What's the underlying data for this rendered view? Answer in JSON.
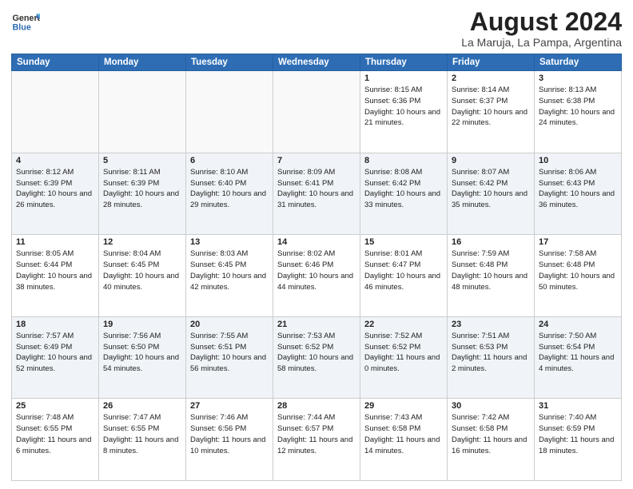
{
  "header": {
    "month": "August 2024",
    "location": "La Maruja, La Pampa, Argentina",
    "logo_line1": "General",
    "logo_line2": "Blue"
  },
  "weekdays": [
    "Sunday",
    "Monday",
    "Tuesday",
    "Wednesday",
    "Thursday",
    "Friday",
    "Saturday"
  ],
  "weeks": [
    [
      {
        "day": "",
        "sunrise": "",
        "sunset": "",
        "daylight": ""
      },
      {
        "day": "",
        "sunrise": "",
        "sunset": "",
        "daylight": ""
      },
      {
        "day": "",
        "sunrise": "",
        "sunset": "",
        "daylight": ""
      },
      {
        "day": "",
        "sunrise": "",
        "sunset": "",
        "daylight": ""
      },
      {
        "day": "1",
        "sunrise": "Sunrise: 8:15 AM",
        "sunset": "Sunset: 6:36 PM",
        "daylight": "Daylight: 10 hours and 21 minutes."
      },
      {
        "day": "2",
        "sunrise": "Sunrise: 8:14 AM",
        "sunset": "Sunset: 6:37 PM",
        "daylight": "Daylight: 10 hours and 22 minutes."
      },
      {
        "day": "3",
        "sunrise": "Sunrise: 8:13 AM",
        "sunset": "Sunset: 6:38 PM",
        "daylight": "Daylight: 10 hours and 24 minutes."
      }
    ],
    [
      {
        "day": "4",
        "sunrise": "Sunrise: 8:12 AM",
        "sunset": "Sunset: 6:39 PM",
        "daylight": "Daylight: 10 hours and 26 minutes."
      },
      {
        "day": "5",
        "sunrise": "Sunrise: 8:11 AM",
        "sunset": "Sunset: 6:39 PM",
        "daylight": "Daylight: 10 hours and 28 minutes."
      },
      {
        "day": "6",
        "sunrise": "Sunrise: 8:10 AM",
        "sunset": "Sunset: 6:40 PM",
        "daylight": "Daylight: 10 hours and 29 minutes."
      },
      {
        "day": "7",
        "sunrise": "Sunrise: 8:09 AM",
        "sunset": "Sunset: 6:41 PM",
        "daylight": "Daylight: 10 hours and 31 minutes."
      },
      {
        "day": "8",
        "sunrise": "Sunrise: 8:08 AM",
        "sunset": "Sunset: 6:42 PM",
        "daylight": "Daylight: 10 hours and 33 minutes."
      },
      {
        "day": "9",
        "sunrise": "Sunrise: 8:07 AM",
        "sunset": "Sunset: 6:42 PM",
        "daylight": "Daylight: 10 hours and 35 minutes."
      },
      {
        "day": "10",
        "sunrise": "Sunrise: 8:06 AM",
        "sunset": "Sunset: 6:43 PM",
        "daylight": "Daylight: 10 hours and 36 minutes."
      }
    ],
    [
      {
        "day": "11",
        "sunrise": "Sunrise: 8:05 AM",
        "sunset": "Sunset: 6:44 PM",
        "daylight": "Daylight: 10 hours and 38 minutes."
      },
      {
        "day": "12",
        "sunrise": "Sunrise: 8:04 AM",
        "sunset": "Sunset: 6:45 PM",
        "daylight": "Daylight: 10 hours and 40 minutes."
      },
      {
        "day": "13",
        "sunrise": "Sunrise: 8:03 AM",
        "sunset": "Sunset: 6:45 PM",
        "daylight": "Daylight: 10 hours and 42 minutes."
      },
      {
        "day": "14",
        "sunrise": "Sunrise: 8:02 AM",
        "sunset": "Sunset: 6:46 PM",
        "daylight": "Daylight: 10 hours and 44 minutes."
      },
      {
        "day": "15",
        "sunrise": "Sunrise: 8:01 AM",
        "sunset": "Sunset: 6:47 PM",
        "daylight": "Daylight: 10 hours and 46 minutes."
      },
      {
        "day": "16",
        "sunrise": "Sunrise: 7:59 AM",
        "sunset": "Sunset: 6:48 PM",
        "daylight": "Daylight: 10 hours and 48 minutes."
      },
      {
        "day": "17",
        "sunrise": "Sunrise: 7:58 AM",
        "sunset": "Sunset: 6:48 PM",
        "daylight": "Daylight: 10 hours and 50 minutes."
      }
    ],
    [
      {
        "day": "18",
        "sunrise": "Sunrise: 7:57 AM",
        "sunset": "Sunset: 6:49 PM",
        "daylight": "Daylight: 10 hours and 52 minutes."
      },
      {
        "day": "19",
        "sunrise": "Sunrise: 7:56 AM",
        "sunset": "Sunset: 6:50 PM",
        "daylight": "Daylight: 10 hours and 54 minutes."
      },
      {
        "day": "20",
        "sunrise": "Sunrise: 7:55 AM",
        "sunset": "Sunset: 6:51 PM",
        "daylight": "Daylight: 10 hours and 56 minutes."
      },
      {
        "day": "21",
        "sunrise": "Sunrise: 7:53 AM",
        "sunset": "Sunset: 6:52 PM",
        "daylight": "Daylight: 10 hours and 58 minutes."
      },
      {
        "day": "22",
        "sunrise": "Sunrise: 7:52 AM",
        "sunset": "Sunset: 6:52 PM",
        "daylight": "Daylight: 11 hours and 0 minutes."
      },
      {
        "day": "23",
        "sunrise": "Sunrise: 7:51 AM",
        "sunset": "Sunset: 6:53 PM",
        "daylight": "Daylight: 11 hours and 2 minutes."
      },
      {
        "day": "24",
        "sunrise": "Sunrise: 7:50 AM",
        "sunset": "Sunset: 6:54 PM",
        "daylight": "Daylight: 11 hours and 4 minutes."
      }
    ],
    [
      {
        "day": "25",
        "sunrise": "Sunrise: 7:48 AM",
        "sunset": "Sunset: 6:55 PM",
        "daylight": "Daylight: 11 hours and 6 minutes."
      },
      {
        "day": "26",
        "sunrise": "Sunrise: 7:47 AM",
        "sunset": "Sunset: 6:55 PM",
        "daylight": "Daylight: 11 hours and 8 minutes."
      },
      {
        "day": "27",
        "sunrise": "Sunrise: 7:46 AM",
        "sunset": "Sunset: 6:56 PM",
        "daylight": "Daylight: 11 hours and 10 minutes."
      },
      {
        "day": "28",
        "sunrise": "Sunrise: 7:44 AM",
        "sunset": "Sunset: 6:57 PM",
        "daylight": "Daylight: 11 hours and 12 minutes."
      },
      {
        "day": "29",
        "sunrise": "Sunrise: 7:43 AM",
        "sunset": "Sunset: 6:58 PM",
        "daylight": "Daylight: 11 hours and 14 minutes."
      },
      {
        "day": "30",
        "sunrise": "Sunrise: 7:42 AM",
        "sunset": "Sunset: 6:58 PM",
        "daylight": "Daylight: 11 hours and 16 minutes."
      },
      {
        "day": "31",
        "sunrise": "Sunrise: 7:40 AM",
        "sunset": "Sunset: 6:59 PM",
        "daylight": "Daylight: 11 hours and 18 minutes."
      }
    ]
  ]
}
